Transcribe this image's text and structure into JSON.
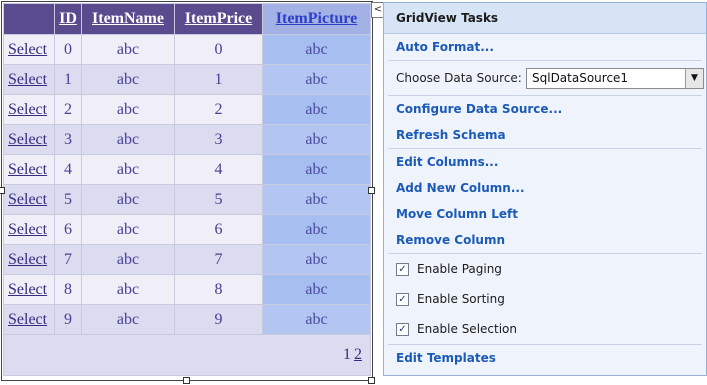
{
  "grid": {
    "columns": [
      "",
      "ID",
      "ItemName",
      "ItemPrice",
      "ItemPicture"
    ],
    "select_label": "Select",
    "rows": [
      {
        "id": "0",
        "name": "abc",
        "price": "0",
        "picture": "abc"
      },
      {
        "id": "1",
        "name": "abc",
        "price": "1",
        "picture": "abc"
      },
      {
        "id": "2",
        "name": "abc",
        "price": "2",
        "picture": "abc"
      },
      {
        "id": "3",
        "name": "abc",
        "price": "3",
        "picture": "abc"
      },
      {
        "id": "4",
        "name": "abc",
        "price": "4",
        "picture": "abc"
      },
      {
        "id": "5",
        "name": "abc",
        "price": "5",
        "picture": "abc"
      },
      {
        "id": "6",
        "name": "abc",
        "price": "6",
        "picture": "abc"
      },
      {
        "id": "7",
        "name": "abc",
        "price": "7",
        "picture": "abc"
      },
      {
        "id": "8",
        "name": "abc",
        "price": "8",
        "picture": "abc"
      },
      {
        "id": "9",
        "name": "abc",
        "price": "9",
        "picture": "abc"
      }
    ],
    "pager": {
      "current": "1",
      "next": "2"
    }
  },
  "smart_tag": {
    "glyph": "<"
  },
  "tasks": {
    "title": "GridView Tasks",
    "auto_format": "Auto Format...",
    "choose_ds_label": "Choose Data Source:",
    "choose_ds_value": "SqlDataSource1",
    "configure_ds": "Configure Data Source...",
    "refresh_schema": "Refresh Schema",
    "edit_columns": "Edit Columns...",
    "add_column": "Add New Column...",
    "move_left": "Move Column Left",
    "remove_column": "Remove Column",
    "enable_paging": "Enable Paging",
    "enable_sorting": "Enable Sorting",
    "enable_selection": "Enable Selection",
    "edit_templates": "Edit Templates"
  },
  "colors": {
    "header_bg": "#5a4a8e",
    "selected_column": "#a7bff0",
    "link": "#1c5ab8"
  }
}
